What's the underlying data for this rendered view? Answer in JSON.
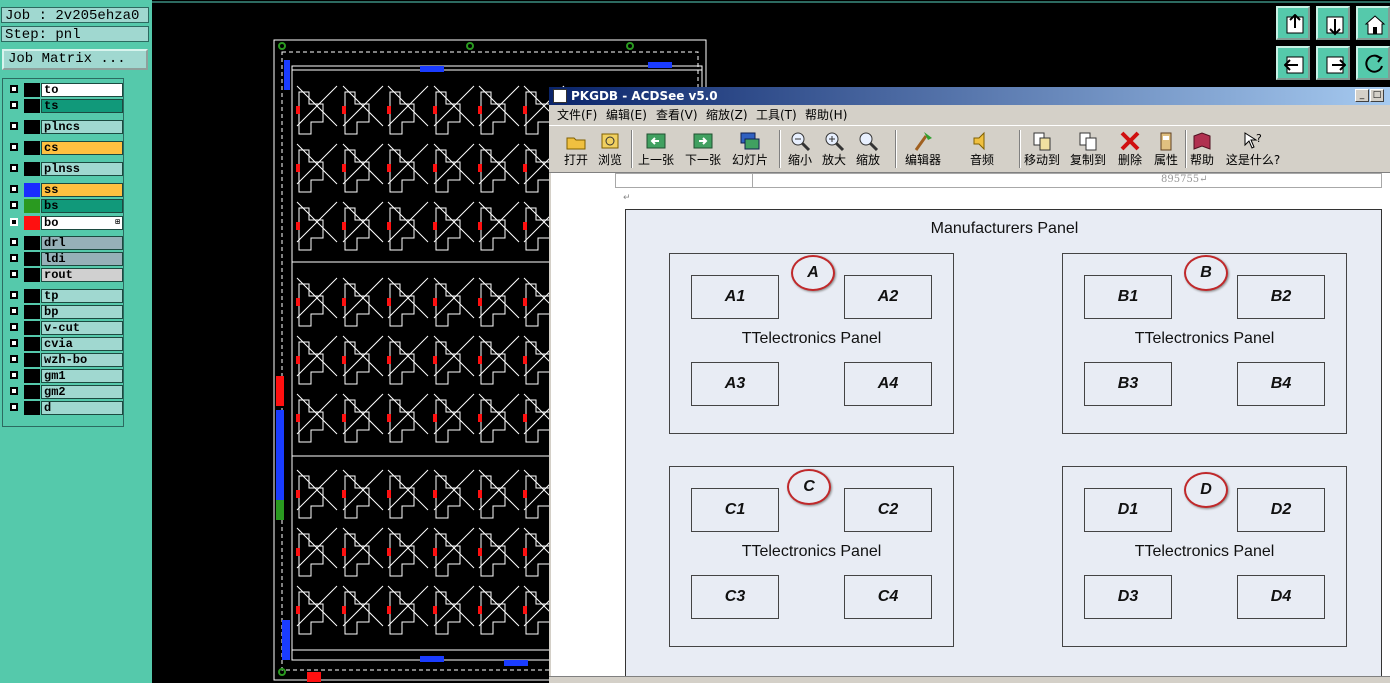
{
  "job": {
    "job_label": "Job : 2v205ehza0",
    "step_label": "Step: pnl",
    "matrix_button": "Job Matrix ..."
  },
  "layers": [
    {
      "name": "to",
      "color": "#ffffff",
      "swatch": "#000000",
      "checked": true
    },
    {
      "name": "ts",
      "color": "#11997a",
      "swatch": "#000000",
      "checked": true
    },
    {
      "name": "plncs",
      "color": "#a0d8d0",
      "swatch": "#000000",
      "checked": true
    },
    {
      "name": "cs",
      "color": "#ffc040",
      "swatch": "#000000",
      "checked": true
    },
    {
      "name": "plnss",
      "color": "#a0d8d0",
      "swatch": "#000000",
      "checked": true
    },
    {
      "name": "ss",
      "color": "#ffc040",
      "swatch": "#1a2cff",
      "checked": true
    },
    {
      "name": "bs",
      "color": "#11997a",
      "swatch": "#2a9a20",
      "checked": true
    },
    {
      "name": "bo",
      "color": "#ffffff",
      "swatch": "#ff1010",
      "checked": false,
      "plus": "⊞"
    },
    {
      "name": "drl",
      "color": "#96b0b8",
      "swatch": "#000000",
      "checked": true
    },
    {
      "name": "ldi",
      "color": "#96b0b8",
      "swatch": "#000000",
      "checked": true
    },
    {
      "name": "rout",
      "color": "#d0d0d0",
      "swatch": "#000000",
      "checked": true
    },
    {
      "name": "tp",
      "color": "#a0d8d0",
      "swatch": "#000000",
      "checked": true
    },
    {
      "name": "bp",
      "color": "#a0d8d0",
      "swatch": "#000000",
      "checked": true
    },
    {
      "name": "v-cut",
      "color": "#a0d8d0",
      "swatch": "#000000",
      "checked": true
    },
    {
      "name": "cvia",
      "color": "#a0d8d0",
      "swatch": "#000000",
      "checked": true
    },
    {
      "name": "wzh-bo",
      "color": "#a0d8d0",
      "swatch": "#000000",
      "checked": true
    },
    {
      "name": "gm1",
      "color": "#a0d8d0",
      "swatch": "#000000",
      "checked": true
    },
    {
      "name": "gm2",
      "color": "#a0d8d0",
      "swatch": "#000000",
      "checked": true
    },
    {
      "name": "d",
      "color": "#a0d8d0",
      "swatch": "#000000",
      "checked": true
    }
  ],
  "nav_buttons": [
    "up-icon",
    "down-icon",
    "home-icon",
    "left-icon",
    "right-icon",
    "rotate-icon"
  ],
  "acdsee": {
    "title": "PKGDB - ACDSee v5.0",
    "window_buttons": [
      "_",
      "□"
    ],
    "menu": [
      "文件(F)",
      "编辑(E)",
      "查看(V)",
      "缩放(Z)",
      "工具(T)",
      "帮助(H)"
    ],
    "toolbar": [
      {
        "label": "打开",
        "icon": "open-folder-icon"
      },
      {
        "label": "浏览",
        "icon": "browse-icon"
      },
      {
        "label": "上一张",
        "icon": "previous-icon"
      },
      {
        "label": "下一张",
        "icon": "next-icon"
      },
      {
        "label": "幻灯片",
        "icon": "slideshow-icon"
      },
      {
        "label": "缩小",
        "icon": "zoom-out-icon"
      },
      {
        "label": "放大",
        "icon": "zoom-in-icon"
      },
      {
        "label": "缩放",
        "icon": "zoom-icon"
      },
      {
        "label": "编辑器",
        "icon": "editor-icon"
      },
      {
        "label": "音频",
        "icon": "audio-icon"
      },
      {
        "label": "移动到",
        "icon": "move-to-icon"
      },
      {
        "label": "复制到",
        "icon": "copy-to-icon"
      },
      {
        "label": "删除",
        "icon": "delete-icon"
      },
      {
        "label": "属性",
        "icon": "properties-icon"
      },
      {
        "label": "帮助",
        "icon": "help-book-icon"
      },
      {
        "label": "这是什么?",
        "icon": "whats-this-icon"
      }
    ],
    "doc_number": "895755↵",
    "return_mark": "↵",
    "diagram": {
      "title": "Manufacturers Panel",
      "panels": [
        {
          "letter": "A",
          "caption": "TTelectronics Panel",
          "cells": [
            "A1",
            "A2",
            "A3",
            "A4"
          ]
        },
        {
          "letter": "B",
          "caption": "TTelectronics Panel",
          "cells": [
            "B1",
            "B2",
            "B3",
            "B4"
          ]
        },
        {
          "letter": "C",
          "caption": "TTelectronics Panel",
          "cells": [
            "C1",
            "C2",
            "C3",
            "C4"
          ]
        },
        {
          "letter": "D",
          "caption": "TTelectronics Panel",
          "cells": [
            "D1",
            "D2",
            "D3",
            "D4"
          ]
        }
      ]
    }
  }
}
